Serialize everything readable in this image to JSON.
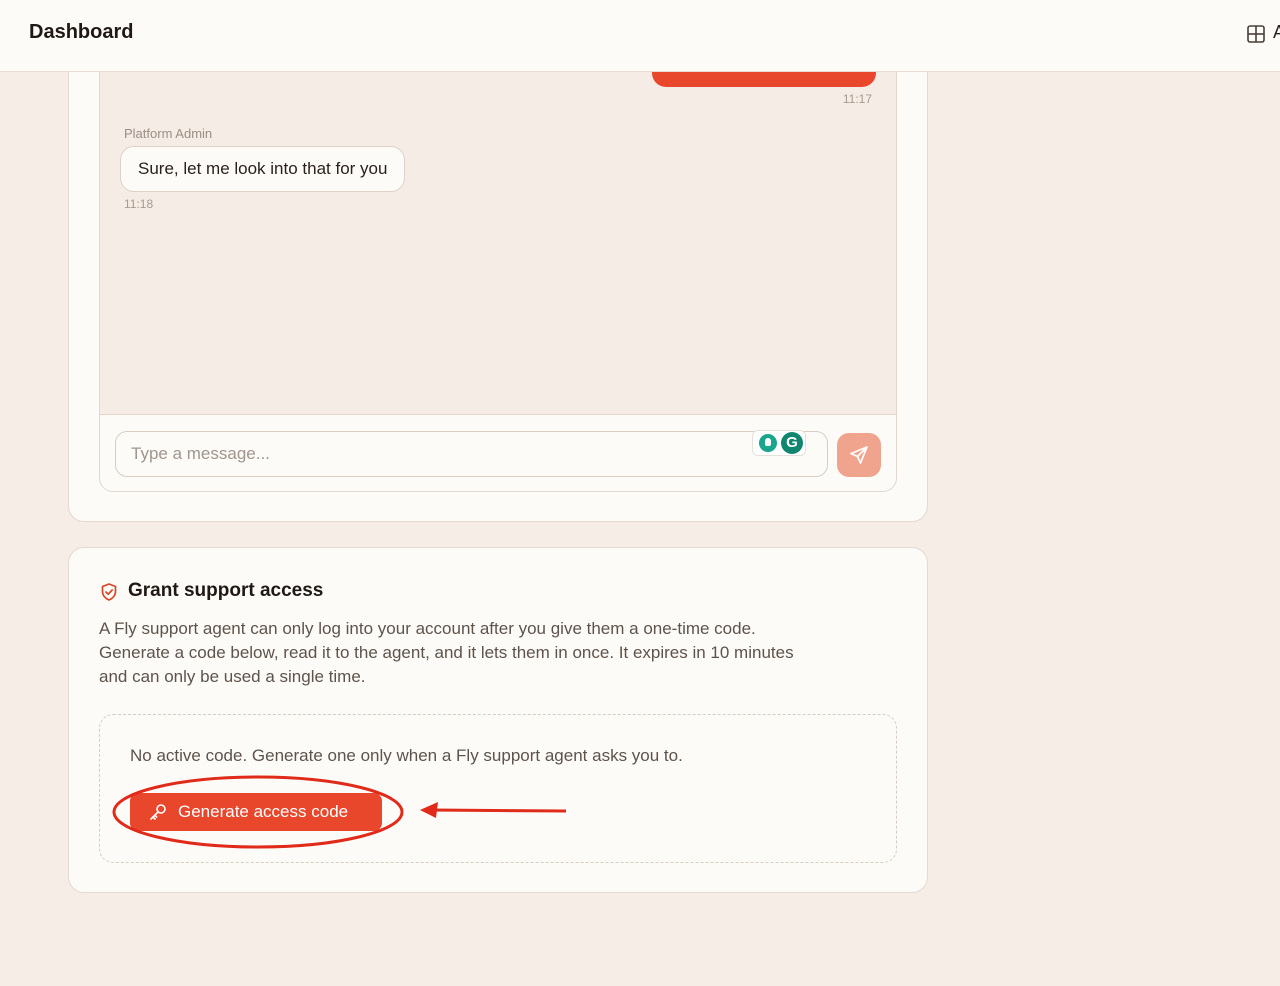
{
  "header": {
    "title": "Dashboard",
    "layout_icon": "grid-layout-icon",
    "clipped_text": "A"
  },
  "chat": {
    "messages": [
      {
        "direction": "outgoing",
        "text": "",
        "time": "11:17"
      },
      {
        "direction": "incoming",
        "sender": "Platform Admin",
        "text": "Sure, let me look into that for you",
        "time": "11:18"
      }
    ],
    "composer": {
      "placeholder": "Type a message...",
      "value": ""
    },
    "extension_icons": [
      "bulb-icon",
      "grammarly-icon"
    ],
    "grammarly_letter": "G",
    "send_icon": "send-icon"
  },
  "grant_access": {
    "icon": "shield-check-icon",
    "title": "Grant support access",
    "description": "A Fly support agent can only log into your account after you give them a one-time code. Generate a code below, read it to the agent, and it lets them in once. It expires in 10 minutes and can only be used a single time.",
    "status_text": "No active code. Generate one only when a Fly support agent asks you to.",
    "button_label": "Generate access code",
    "button_icon": "key-icon"
  },
  "colors": {
    "accent": "#e8472c",
    "send_disabled": "#f0a38d",
    "page_bg": "#f6ede6",
    "card_bg": "#fdfbf8",
    "annotation": "#e02a1a"
  }
}
